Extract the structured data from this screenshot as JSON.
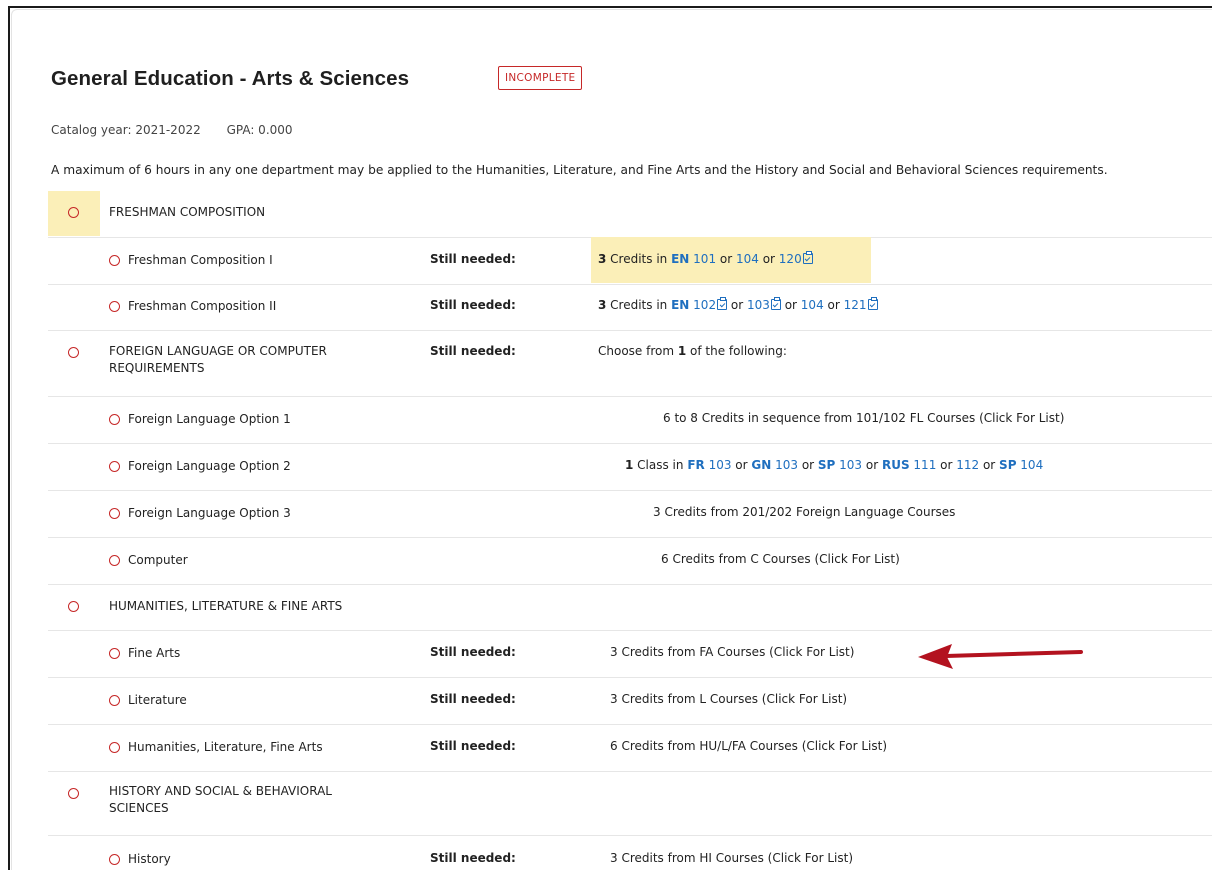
{
  "header": {
    "title": "General Education - Arts & Sciences",
    "status_badge": "INCOMPLETE",
    "catalog_year": "Catalog year:  2021-2022",
    "gpa": "GPA:  0.000",
    "note": "A maximum of 6 hours in any one department may be applied to the Humanities, Literature, and Fine Arts and the History and Social and Behavioral Sciences requirements."
  },
  "labels": {
    "still_needed": "Still needed:"
  },
  "requirements": {
    "freshman_comp": {
      "label": "FRESHMAN COMPOSITION",
      "comp1": {
        "label": "Freshman Composition I",
        "req": {
          "count": "3",
          "text1": " Credits in ",
          "subj": "EN",
          "c1": "101",
          "or1": " or ",
          "c2": "104",
          "or2": " or ",
          "c3": "120"
        }
      },
      "comp2": {
        "label": "Freshman Composition II",
        "req": {
          "count": "3",
          "text1": " Credits in ",
          "subj": "EN",
          "c1": "102",
          "or1": " or ",
          "c2": "103",
          "or2": " or ",
          "c3": "104",
          "or3": " or ",
          "c4": "121"
        }
      }
    },
    "foreign_lang": {
      "label": "FOREIGN LANGUAGE OR COMPUTER REQUIREMENTS",
      "req": {
        "pre": "Choose from ",
        "count": "1",
        "post": " of the following:"
      },
      "opt1": {
        "label": "Foreign Language Option 1",
        "req": "6 to 8 Credits in sequence from 101/102 FL Courses (Click For List)"
      },
      "opt2": {
        "label": "Foreign Language Option 2",
        "req": {
          "count": "1",
          "t1": " Class in ",
          "s1": "FR",
          "n1": " 103",
          "o1": " or ",
          "s2": "GN",
          "n2": " 103",
          "o2": " or ",
          "s3": "SP",
          "n3": " 103",
          "o3": " or ",
          "s4": "RUS",
          "n4": " 111",
          "o4": " or ",
          "n5": "112",
          "o5": " or ",
          "s6": "SP",
          "n6": " 104"
        }
      },
      "opt3": {
        "label": "Foreign Language Option 3",
        "req": "3 Credits from 201/202 Foreign Language Courses"
      },
      "computer": {
        "label": "Computer",
        "req": "6 Credits from C Courses (Click For List)"
      }
    },
    "humanities": {
      "label": "HUMANITIES, LITERATURE & FINE ARTS",
      "fine_arts": {
        "label": "Fine Arts",
        "req": "3 Credits from FA Courses (Click For List)"
      },
      "literature": {
        "label": "Literature",
        "req": "3 Credits from L Courses (Click For List)"
      },
      "hu_l_fa": {
        "label": "Humanities, Literature, Fine Arts",
        "req": "6 Credits from HU/L/FA Courses (Click For List)"
      }
    },
    "history_social": {
      "label": "HISTORY AND SOCIAL & BEHAVIORAL SCIENCES",
      "history": {
        "label": "History",
        "req": "3 Credits from HI Courses (Click For List)"
      }
    }
  },
  "colors": {
    "incomplete_red": "#c62828",
    "link_blue": "#1f6fbf",
    "highlight_yellow": "#fbefb8",
    "arrow_red": "#b3121f"
  },
  "icons": [
    "incomplete-circle-icon",
    "course-prereq-check-icon",
    "annotation-arrow-icon"
  ]
}
